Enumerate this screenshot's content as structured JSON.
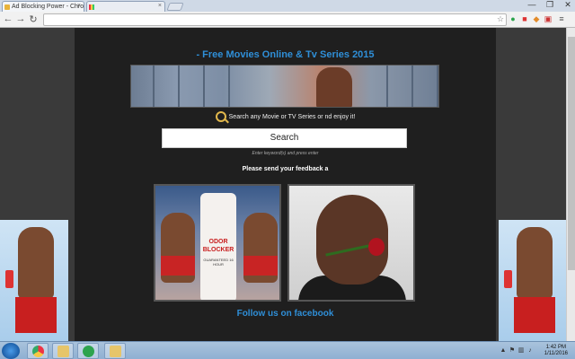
{
  "browser": {
    "tabs": [
      {
        "label": "Ad Blocking Power - Chro",
        "active": true
      },
      {
        "label": "",
        "active": false
      }
    ],
    "address": "",
    "window_controls": [
      "—",
      "❐",
      "✕"
    ]
  },
  "page": {
    "title": "- Free Movies Online & Tv Series 2015",
    "search_hint": "Search any Movie or TV Series or          nd enjoy it!",
    "search_label": "Search",
    "enter_hint": "Enter keyword(s) and press enter",
    "feedback": "Please send your feedback a",
    "follow": "Follow us on facebook",
    "blocker_ad": {
      "brand": "ODOR BLOCKER",
      "sub": "GUARANTEED 16 HOUR"
    }
  },
  "taskbar": {
    "time": "1:42 PM",
    "date": "1/11/2016"
  },
  "colors": {
    "accent": "#2f8fd8",
    "page_bg": "#1f1f1f"
  }
}
